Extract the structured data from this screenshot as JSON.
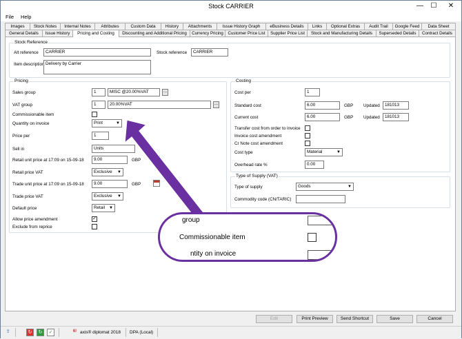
{
  "window": {
    "title": "Stock CARRIER"
  },
  "menu": [
    "File",
    "Help"
  ],
  "tabs_row1": [
    "Images",
    "Stock Notes",
    "Internal Notes",
    "Attributes",
    "Custom Data",
    "History",
    "Attachments",
    "Issue History Graph",
    "eBusiness Details",
    "Links",
    "Optional Extras",
    "Audit Trail",
    "Google Feed",
    "Data Sheet"
  ],
  "tabs_row2": [
    "General Details",
    "Issue History",
    "Pricing and Costing",
    "Discounting and Additional Pricing",
    "Currency Pricing",
    "Customer Price List",
    "Supplier Price List",
    "Stock and Manufacturing Details",
    "Superseded Details",
    "Contract Details"
  ],
  "active_tab": "Pricing and Costing",
  "stock_reference": {
    "group_label": "Stock Reference",
    "alt_reference_label": "Alt reference",
    "alt_reference": "CARRIER",
    "stock_reference_label": "Stock reference",
    "stock_reference": "CARRIER",
    "item_description_label": "Item description",
    "item_description": "Delivery by Carrier"
  },
  "pricing": {
    "group_label": "Pricing",
    "sales_group_label": "Sales group",
    "sales_group_code": "1",
    "sales_group_desc": "MISC @20.00%VAT",
    "vat_group_label": "VAT group",
    "vat_group_code": "1",
    "vat_group_desc": "20.00%VAT",
    "commissionable_label": "Commissionable item",
    "qty_on_invoice_label": "Quantity on invoice",
    "qty_on_invoice": "Print",
    "price_per_label": "Price per",
    "price_per": "1",
    "sell_in_label": "Sell in",
    "sell_in": "Units",
    "retail_unit_price_label": "Retail unit price at 17:09 on 15-09-18",
    "retail_unit_price": "9.00",
    "retail_currency": "GBP",
    "retail_vat_label": "Retail price VAT",
    "retail_vat": "Exclusive",
    "trade_unit_price_label": "Trade unit price at 17:09 on 15-09-18",
    "trade_unit_price": "9.00",
    "trade_currency": "GBP",
    "trade_vat_label": "Trade price VAT",
    "trade_vat": "Exclusive",
    "default_price_label": "Default price",
    "default_price": "Retail",
    "allow_amendment_label": "Allow price amendment",
    "allow_amendment_checked": true,
    "exclude_reprice_label": "Exclude from reprice"
  },
  "costing": {
    "group_label": "Costing",
    "cost_per_label": "Cost per",
    "cost_per": "1",
    "standard_cost_label": "Standard cost",
    "standard_cost": "6.00",
    "standard_currency": "GBP",
    "standard_updated_label": "Updated",
    "standard_updated": "181013",
    "current_cost_label": "Current cost",
    "current_cost": "6.00",
    "current_currency": "GBP",
    "current_updated_label": "Updated",
    "current_updated": "181013",
    "transfer_label": "Transfer cost from order to invoice",
    "invoice_amend_label": "Invoice cost amendment",
    "crnote_amend_label": "Cr Note cost amendment",
    "cost_type_label": "Cost type",
    "cost_type": "Material",
    "overhead_label": "Overhead rate %",
    "overhead": "0.00"
  },
  "supply": {
    "group_label": "Type of Supply (VAT)",
    "type_label": "Type of supply",
    "type": "Goods",
    "commodity_label": "Commodity code (CN/TARIC)",
    "commodity": ""
  },
  "zoom": {
    "line1": "group",
    "line2": "Commissionable item",
    "line3": "ntity on invoice"
  },
  "buttons": {
    "edit": "Edit",
    "print_preview": "Print Preview",
    "send_shortcut": "Send Shortcut",
    "save": "Save",
    "cancel": "Cancel"
  },
  "status": {
    "app": "axis® diplomat 2018",
    "db": "DPA (Local)"
  },
  "colors": {
    "callout": "#6a2fa0"
  }
}
